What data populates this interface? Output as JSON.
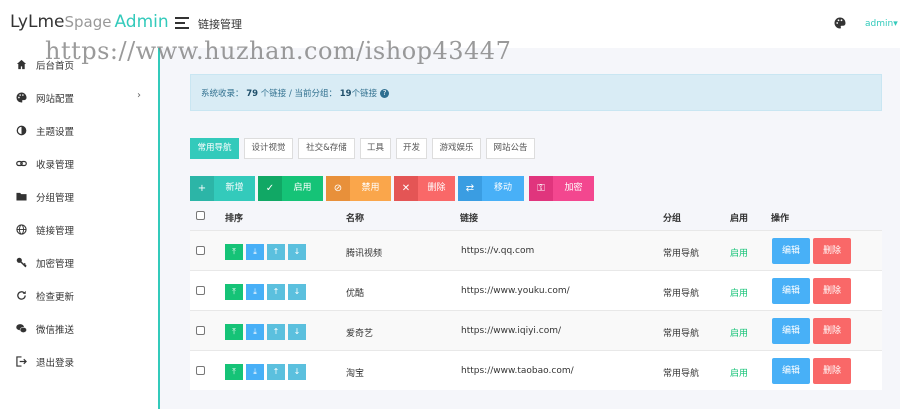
{
  "brand": {
    "part1": "LyLme",
    "part2": "Spage",
    "part3": "Admin"
  },
  "header": {
    "title": "链接管理",
    "user": "admin",
    "user_caret": "▾"
  },
  "watermark": "https://www.huzhan.com/ishop43447",
  "sidebar": {
    "items": [
      {
        "label": "后台首页",
        "icon": "home-icon"
      },
      {
        "label": "网站配置",
        "icon": "palette-icon",
        "chevron": "›"
      },
      {
        "label": "主题设置",
        "icon": "contrast-icon"
      },
      {
        "label": "收录管理",
        "icon": "link-icon"
      },
      {
        "label": "分组管理",
        "icon": "folder-icon"
      },
      {
        "label": "链接管理",
        "icon": "globe-icon"
      },
      {
        "label": "加密管理",
        "icon": "key-icon"
      },
      {
        "label": "检查更新",
        "icon": "refresh-icon"
      },
      {
        "label": "微信推送",
        "icon": "wechat-icon"
      },
      {
        "label": "退出登录",
        "icon": "logout-icon"
      }
    ]
  },
  "alert": {
    "prefix": "系统收录：",
    "total": "79",
    "mid": "个链接 / 当前分组：",
    "group_count": "19",
    "suffix": "个链接"
  },
  "categories": [
    "常用导航",
    "设计视觉",
    "社交&存储",
    "工具",
    "开发",
    "游戏娱乐",
    "网站公告"
  ],
  "toolbar": [
    {
      "label": "新增",
      "icon": "plus-icon",
      "color": "#33cabb",
      "iconBg": "#2cb5a7"
    },
    {
      "label": "启用",
      "icon": "check-icon",
      "color": "#15c377",
      "iconBg": "#11a865"
    },
    {
      "label": "禁用",
      "icon": "ban-icon",
      "color": "#faa64b",
      "iconBg": "#e8903a"
    },
    {
      "label": "删除",
      "icon": "close-icon",
      "color": "#f96868",
      "iconBg": "#e45555"
    },
    {
      "label": "移动",
      "icon": "move-icon",
      "color": "#48b0f7",
      "iconBg": "#3a9de2"
    },
    {
      "label": "加密",
      "icon": "key-icon",
      "color": "#f3478f",
      "iconBg": "#e0357d"
    }
  ],
  "table": {
    "headers": [
      "排序",
      "名称",
      "链接",
      "分组",
      "启用",
      "操作"
    ],
    "sort_icons": [
      "⤒",
      "⤓",
      "↑",
      "↓"
    ],
    "edit_label": "编辑",
    "delete_label": "删除",
    "rows": [
      {
        "name": "腾讯视频",
        "url": "https://v.qq.com",
        "group": "常用导航",
        "status": "启用"
      },
      {
        "name": "优酷",
        "url": "https://www.youku.com/",
        "group": "常用导航",
        "status": "启用"
      },
      {
        "name": "爱奇艺",
        "url": "https://www.iqiyi.com/",
        "group": "常用导航",
        "status": "启用"
      },
      {
        "name": "淘宝",
        "url": "https://www.taobao.com/",
        "group": "常用导航",
        "status": "启用"
      }
    ]
  },
  "colors": {
    "accent": "#33cabb",
    "success": "#15c377",
    "info": "#48b0f7",
    "danger": "#f96868"
  }
}
